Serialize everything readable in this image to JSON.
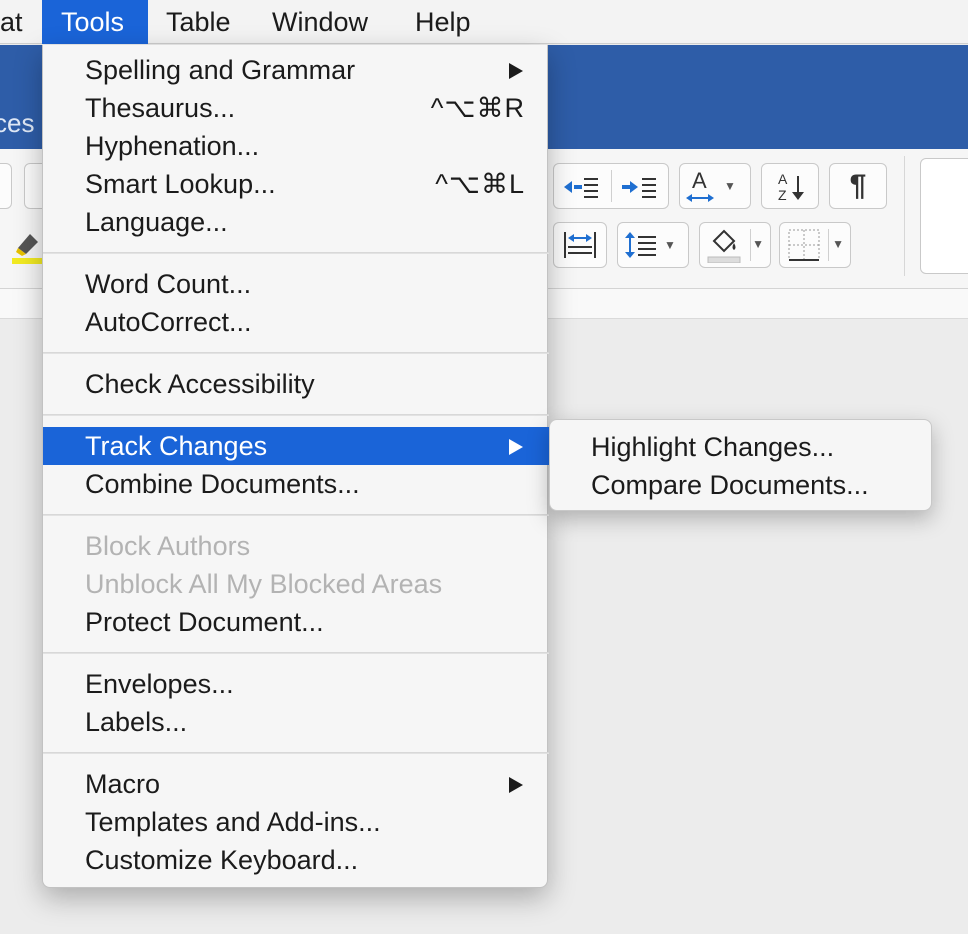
{
  "menubar": {
    "items": [
      {
        "label": "at"
      },
      {
        "label": "Tools"
      },
      {
        "label": "Table"
      },
      {
        "label": "Window"
      },
      {
        "label": "Help"
      }
    ]
  },
  "ribbon": {
    "tab_fragment": "ces",
    "pilcrow": "¶"
  },
  "tools_menu": {
    "groups": [
      [
        {
          "label": "Spelling and Grammar",
          "submenu": true
        },
        {
          "label": "Thesaurus...",
          "shortcut": "^⌥⌘R"
        },
        {
          "label": "Hyphenation..."
        },
        {
          "label": "Smart Lookup...",
          "shortcut": "^⌥⌘L"
        },
        {
          "label": "Language..."
        }
      ],
      [
        {
          "label": "Word Count..."
        },
        {
          "label": "AutoCorrect..."
        }
      ],
      [
        {
          "label": "Check Accessibility"
        }
      ],
      [
        {
          "label": "Track Changes",
          "submenu": true,
          "selected": true
        },
        {
          "label": "Combine Documents..."
        }
      ],
      [
        {
          "label": "Block Authors",
          "disabled": true
        },
        {
          "label": "Unblock All My Blocked Areas",
          "disabled": true
        },
        {
          "label": "Protect Document..."
        }
      ],
      [
        {
          "label": "Envelopes..."
        },
        {
          "label": "Labels..."
        }
      ],
      [
        {
          "label": "Macro",
          "submenu": true
        },
        {
          "label": "Templates and Add-ins..."
        },
        {
          "label": "Customize Keyboard..."
        }
      ]
    ]
  },
  "track_changes_submenu": {
    "items": [
      {
        "label": "Highlight Changes..."
      },
      {
        "label": "Compare Documents..."
      }
    ]
  },
  "colors": {
    "selection": "#1a64d8",
    "ribbon_blue": "#2e5da8",
    "disabled_text": "#b3b3b3"
  }
}
